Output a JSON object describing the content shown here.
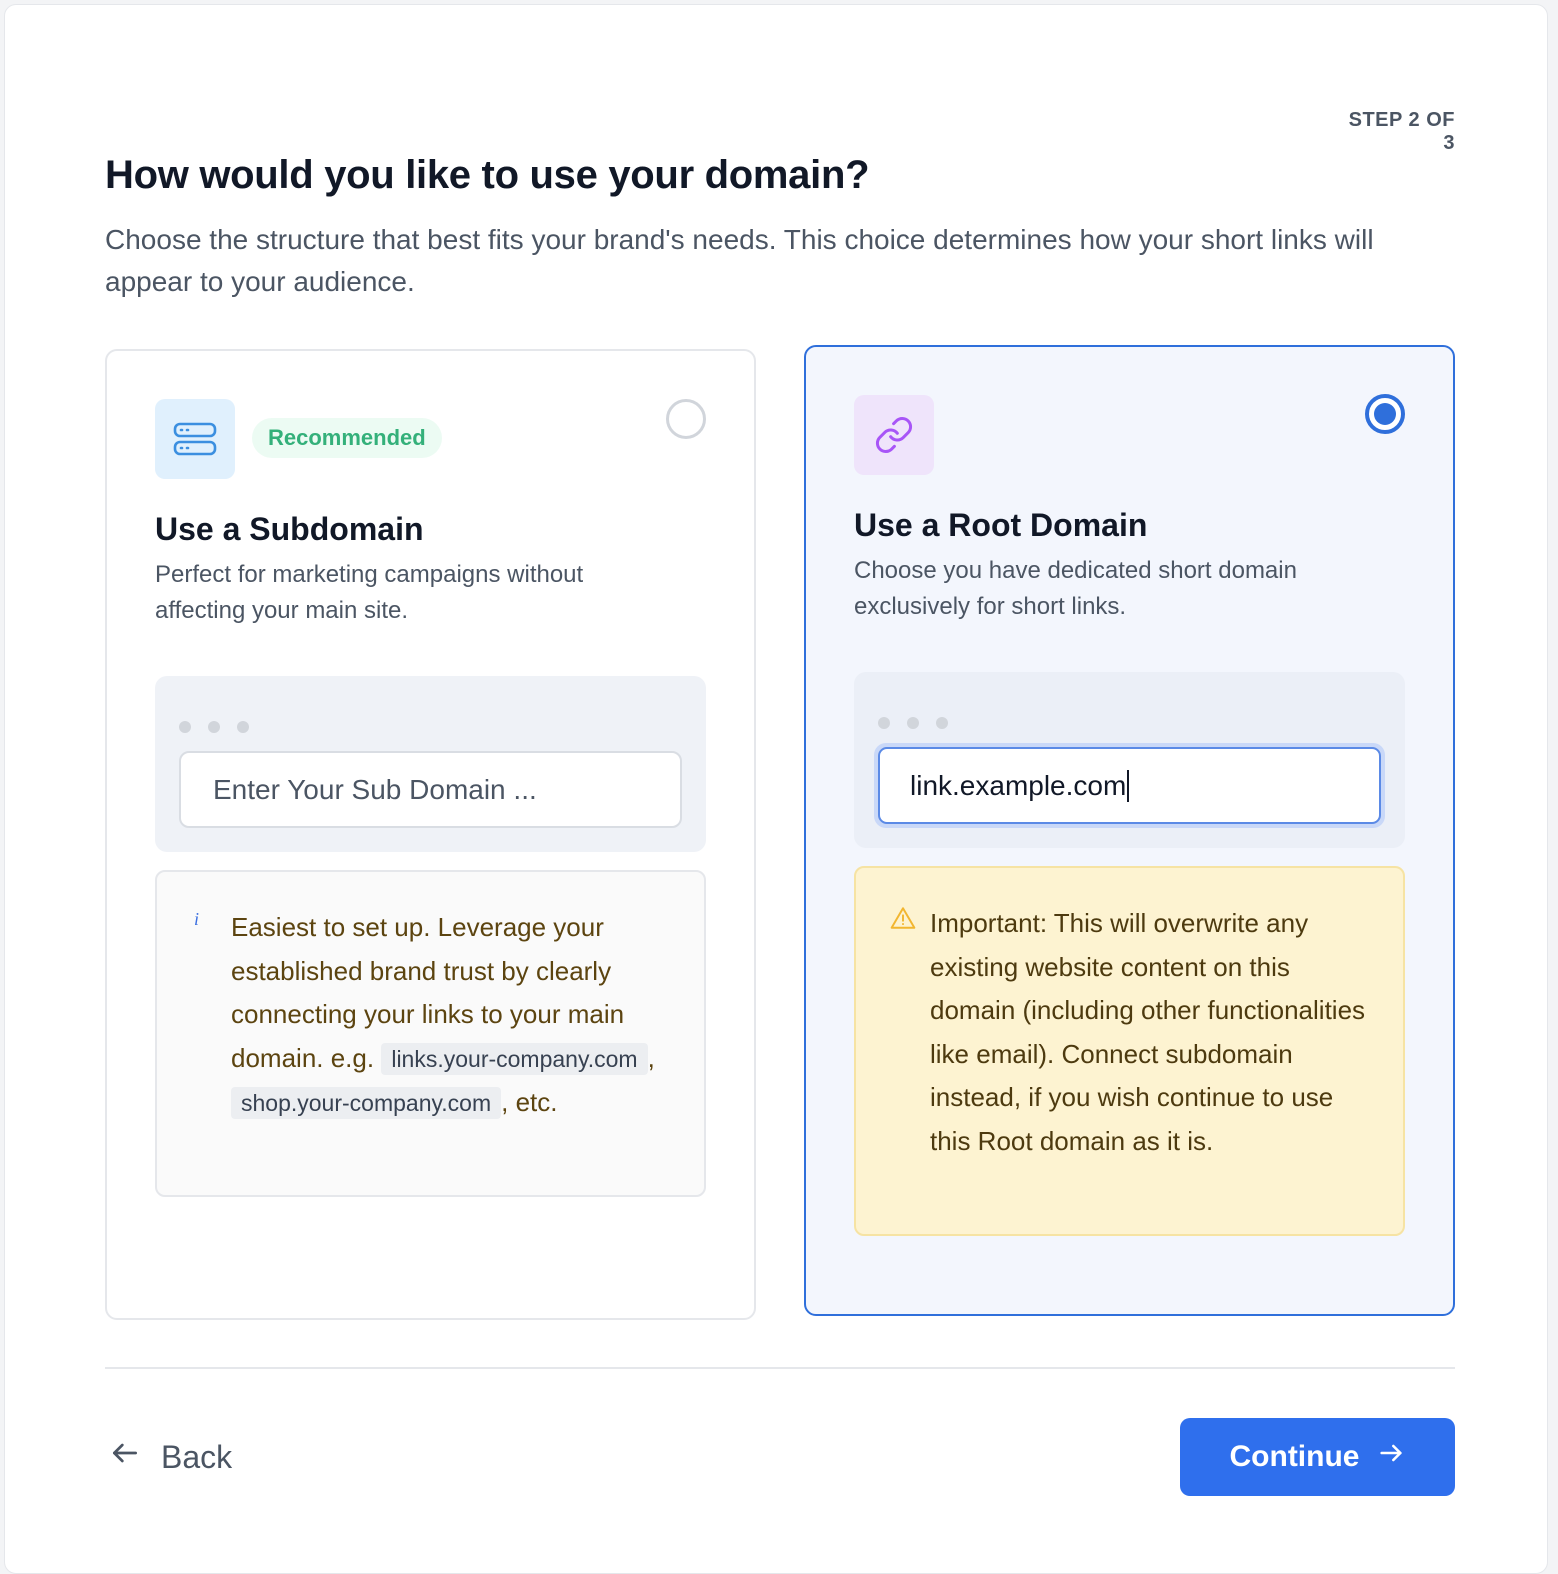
{
  "header": {
    "step": "STEP 2 OF 3",
    "title": "How would you like to use your domain?",
    "subtitle": "Choose the structure that best fits your brand's needs. This choice determines how your short links will appear to your audience."
  },
  "options": {
    "subdomain": {
      "icon": "server-stack-icon",
      "badge": "Recommended",
      "title": "Use a Subdomain",
      "description": "Perfect for marketing campaigns without affecting your main site.",
      "selected": false,
      "input_placeholder": "Enter Your Sub Domain ...",
      "input_value": "",
      "note_icon": "info-icon",
      "note_lead": "Easiest to set up. Leverage your established brand trust by clearly connecting your links to your main domain. e.g.",
      "example_1": "links.your-company.com",
      "separator": ",",
      "example_2": "shop.your-company.com",
      "note_tail": ", etc."
    },
    "root": {
      "icon": "link-icon",
      "title": "Use a Root Domain",
      "description": "Choose you have dedicated short domain exclusively for short links.",
      "selected": true,
      "input_value": "link.example.com",
      "note_icon": "warning-icon",
      "note": "Important: This will overwrite any existing website content on this domain (including other functionalities like email). Connect subdomain instead, if you wish continue to use this Root domain as it is."
    }
  },
  "footer": {
    "back_label": "Back",
    "continue_label": "Continue"
  },
  "colors": {
    "accent": "#2f6fed",
    "selected_border": "#2f6fdb",
    "badge_text": "#34b07a",
    "warning_bg": "#fdf3d1"
  }
}
